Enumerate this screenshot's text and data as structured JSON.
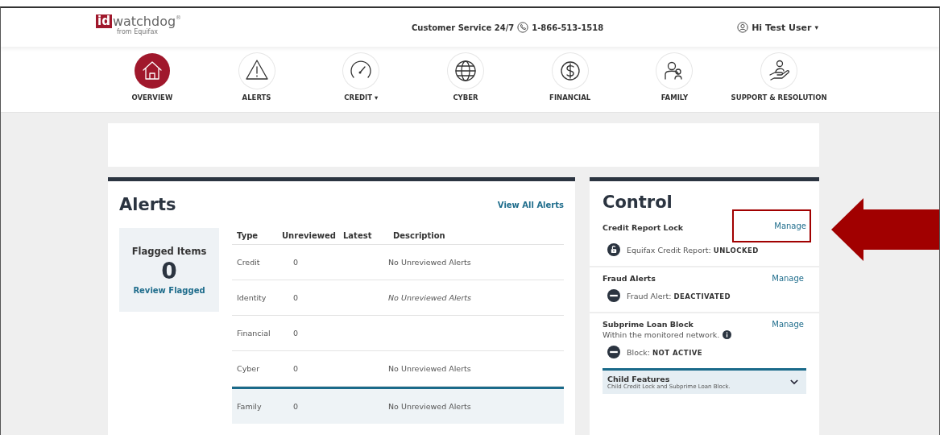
{
  "header": {
    "logo_mark": "id",
    "logo_word": "watchdog",
    "logo_reg": "®",
    "logo_sub": "from Equifax",
    "service_label": "Customer Service 24/7",
    "phone": "1-866-513-1518",
    "user_label": "Hi Test User",
    "user_caret": "▾"
  },
  "nav": [
    {
      "kind": "home",
      "label": "OVERVIEW",
      "selected": true
    },
    {
      "kind": "warning",
      "label": "ALERTS",
      "selected": false
    },
    {
      "kind": "gauge",
      "label": "CREDIT",
      "caret": "▾",
      "selected": false
    },
    {
      "kind": "globe",
      "label": "CYBER",
      "selected": false
    },
    {
      "kind": "dollar",
      "label": "FINANCIAL",
      "selected": false
    },
    {
      "kind": "people",
      "label": "FAMILY",
      "selected": false
    },
    {
      "kind": "hand",
      "label": "SUPPORT & RESOLUTION",
      "selected": false
    }
  ],
  "alerts": {
    "title": "Alerts",
    "view_all": "View All Alerts",
    "flagged": {
      "title": "Flagged Items",
      "count": "0",
      "link": "Review Flagged"
    },
    "columns": [
      "Type",
      "Unreviewed",
      "Latest",
      "Description"
    ],
    "rows": [
      {
        "type": "Credit",
        "unreviewed": "0",
        "description": "No Unreviewed Alerts",
        "italic": false,
        "selected": false
      },
      {
        "type": "Identity",
        "unreviewed": "0",
        "description": "No Unreviewed Alerts",
        "italic": true,
        "selected": false
      },
      {
        "type": "Financial",
        "unreviewed": "0",
        "selected": false
      },
      {
        "type": "Cyber",
        "unreviewed": "0",
        "description": "No Unreviewed Alerts",
        "italic": false,
        "selected": false
      },
      {
        "type": "Family",
        "unreviewed": "0",
        "description": "No Unreviewed Alerts",
        "italic": false,
        "selected": true
      }
    ]
  },
  "control": {
    "title": "Control",
    "sections": [
      {
        "title": "Credit Report Lock",
        "action": "Manage",
        "highlighted": true,
        "kind": "unlocked",
        "status": "Equifax Credit Report: **UNLOCKED**"
      },
      {
        "title": "Fraud Alerts",
        "action": "Manage",
        "highlighted": false,
        "kind": "inactive",
        "status": "Fraud Alert: **DEACTIVATED**"
      },
      {
        "title": "Subprime Loan Block",
        "subtitle": "Within the monitored network.",
        "info": true,
        "action": "Manage",
        "highlighted": false,
        "kind": "inactive",
        "status": "Block: **NOT ACTIVE**"
      }
    ],
    "child_features": {
      "title": "Child Features",
      "subtitle": "Child Credit Lock and Subprime Loan Block.",
      "expanded": false
    }
  }
}
